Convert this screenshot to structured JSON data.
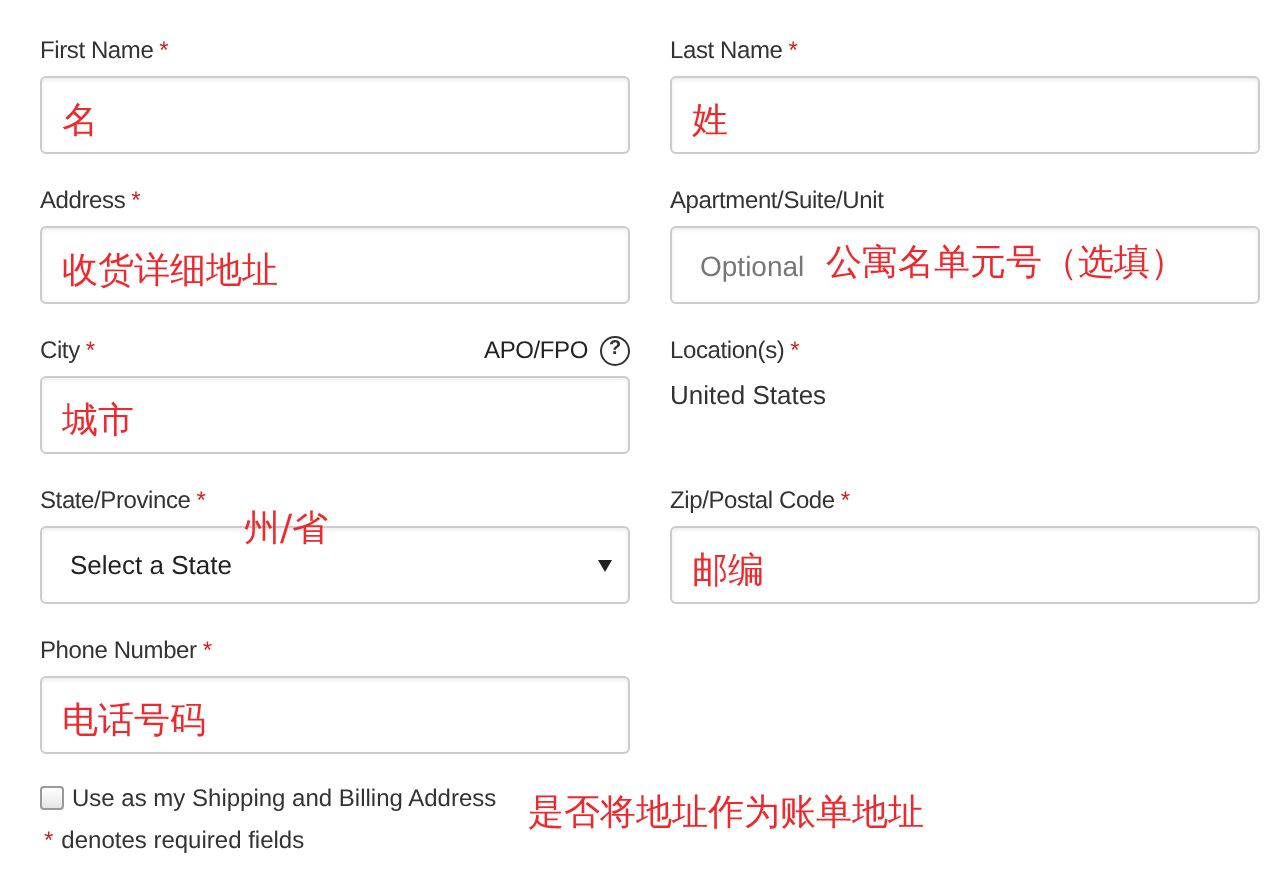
{
  "fields": [
    {
      "kind": "text",
      "label": "First Name",
      "required_mark": "*",
      "annotation": "名"
    },
    {
      "kind": "text",
      "label": "Last Name",
      "required_mark": "*",
      "annotation": "姓"
    },
    {
      "kind": "text",
      "label": "Address",
      "required_mark": "*",
      "annotation": "收货详细地址"
    },
    {
      "kind": "text",
      "label": "Apartment/Suite/Unit",
      "placeholder": "Optional",
      "annotation": "公寓名单元号（选填）"
    },
    {
      "kind": "text",
      "label": "City",
      "required_mark": "*",
      "aside": "APO/FPO",
      "help": "?",
      "annotation": "城市"
    },
    {
      "kind": "static",
      "label": "Location(s)",
      "required_mark": "*",
      "value": "United States"
    },
    {
      "kind": "select",
      "label": "State/Province",
      "required_mark": "*",
      "value": "Select a State",
      "annotation": "州/省"
    },
    {
      "kind": "text",
      "label": "Zip/Postal Code",
      "required_mark": "*",
      "annotation": "邮编"
    },
    {
      "kind": "text",
      "label": "Phone Number",
      "required_mark": "*",
      "annotation": "电话号码"
    }
  ],
  "billing_checkbox": {
    "label": "Use as my Shipping and Billing Address",
    "checked": false,
    "annotation": "是否将地址作为账单地址"
  },
  "footnote": {
    "mark": "*",
    "text": "denotes required fields"
  }
}
